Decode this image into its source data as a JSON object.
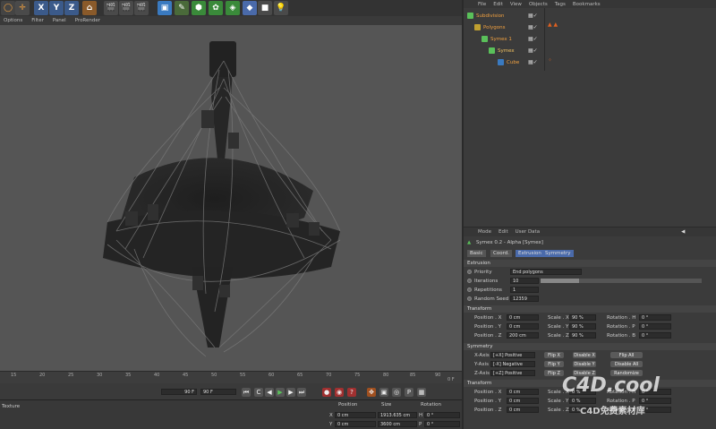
{
  "toolbar": {
    "xyz": [
      "X",
      "Y",
      "Z"
    ]
  },
  "viewport_menu": [
    "Options",
    "Filter",
    "Panel",
    "ProRender"
  ],
  "timeline": {
    "ticks": [
      "15",
      "20",
      "25",
      "30",
      "35",
      "40",
      "45",
      "50",
      "55",
      "60",
      "65",
      "70",
      "75",
      "80",
      "85",
      "90"
    ],
    "end_frame": "0 F",
    "frame_a": "90 F",
    "frame_b": "90 F"
  },
  "bottom": {
    "left_label": "Texture",
    "headers": [
      "Position",
      "Size",
      "Rotation"
    ],
    "rows": [
      [
        "X",
        "0 cm",
        "1913.635 cm",
        "H",
        "0 °"
      ],
      [
        "Y",
        "0 cm",
        "3600 cm",
        "P",
        "0 °"
      ]
    ]
  },
  "obj_menu": [
    "File",
    "Edit",
    "View",
    "Objects",
    "Tags",
    "Bookmarks"
  ],
  "objects": [
    "Subdivision",
    "Polygons",
    "Symex 1",
    "Symex",
    "Cube"
  ],
  "attr_menu": [
    "Mode",
    "Edit",
    "User Data"
  ],
  "attr_title": "Symex 0.2 - Alpha [Symex]",
  "tabs": [
    "Basic",
    "Coord.",
    "Extrusion",
    "Symmetry"
  ],
  "extrusion": {
    "section": "Extrusion",
    "priority_label": "Priority",
    "priority_value": "End polygons",
    "iterations_label": "Iterations",
    "iterations_value": "10",
    "repetitions_label": "Repetitions",
    "repetitions_value": "1",
    "seed_label": "Random Seed",
    "seed_value": "12359"
  },
  "transform1": {
    "section": "Transform",
    "pos": [
      [
        "Position . X",
        "0 cm"
      ],
      [
        "Position . Y",
        "0 cm"
      ],
      [
        "Position . Z",
        "200 cm"
      ]
    ],
    "scale": [
      [
        "Scale . X",
        "90 %"
      ],
      [
        "Scale . Y",
        "90 %"
      ],
      [
        "Scale . Z",
        "90 %"
      ]
    ],
    "rot": [
      [
        "Rotation . H",
        "0 °"
      ],
      [
        "Rotation . P",
        "0 °"
      ],
      [
        "Rotation . B",
        "0 °"
      ]
    ]
  },
  "symmetry": {
    "section": "Symmetry",
    "axes": [
      [
        "X-Axis",
        "[+X] Positive",
        "Flip X",
        "Disable X",
        "Flip All"
      ],
      [
        "Y-Axis",
        "[-X] Negative",
        "Flip Y",
        "Disable Y",
        "Disable All"
      ],
      [
        "Z-Axis",
        "[+Z] Positive",
        "Flip Z",
        "Disable Z",
        "Randomize"
      ]
    ]
  },
  "transform2": {
    "section": "Transform",
    "pos": [
      [
        "Position . X",
        "0 cm"
      ],
      [
        "Position . Y",
        "0 cm"
      ],
      [
        "Position . Z",
        "0 cm"
      ]
    ],
    "scale": [
      [
        "Scale . X",
        "0 %"
      ],
      [
        "Scale . Y",
        "0 %"
      ],
      [
        "Scale . Z",
        "0 %"
      ]
    ],
    "rot": [
      [
        "Rotation . H",
        "0 °"
      ],
      [
        "Rotation . P",
        "0 °"
      ],
      [
        "Rotation . B",
        "0 °"
      ]
    ]
  },
  "watermark": {
    "logo": "C4D.cool",
    "sub": "C4D免费素材库"
  },
  "colors": {
    "accent": "#f0a040",
    "green": "#5ac05a"
  }
}
